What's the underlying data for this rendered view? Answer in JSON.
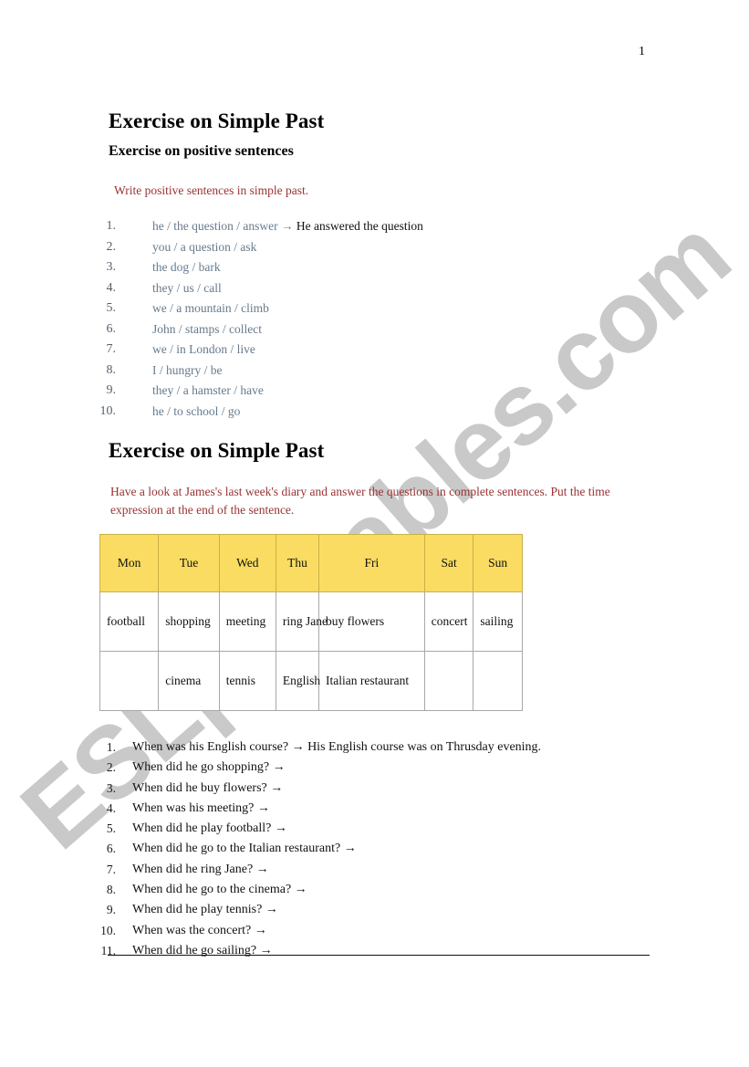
{
  "document": {
    "page_number": "1",
    "watermark": "ESLprintables.com"
  },
  "section_one": {
    "title": "Exercise on Simple Past",
    "subtitle": "Exercise on positive sentences",
    "instruction": "Write positive sentences in simple past.",
    "items": [
      {
        "num": "1.",
        "prompt": "he / the question / answer → ",
        "answer": "He answered the question"
      },
      {
        "num": "2.",
        "prompt": "you / a question / ask",
        "answer": ""
      },
      {
        "num": "3.",
        "prompt": "the dog / bark",
        "answer": ""
      },
      {
        "num": "4.",
        "prompt": "they / us / call",
        "answer": ""
      },
      {
        "num": "5.",
        "prompt": "we / a mountain / climb",
        "answer": ""
      },
      {
        "num": "6.",
        "prompt": "John / stamps / collect",
        "answer": ""
      },
      {
        "num": "7.",
        "prompt": "we / in London / live",
        "answer": ""
      },
      {
        "num": "8.",
        "prompt": "I / hungry / be",
        "answer": ""
      },
      {
        "num": "9.",
        "prompt": "they / a hamster / have",
        "answer": ""
      },
      {
        "num": "10.",
        "prompt": "he / to school / go",
        "answer": ""
      }
    ]
  },
  "section_two": {
    "title": "Exercise on Simple Past",
    "instruction": "Have a look at James's last week's diary and answer the questions in complete sentences. Put the time expression at the end of the sentence.",
    "diary": {
      "headers": [
        "Mon",
        "Tue",
        "Wed",
        "Thu",
        "Fri",
        "Sat",
        "Sun"
      ],
      "rows": [
        [
          "football",
          "shopping",
          "meeting",
          "ring Jane",
          "buy flowers",
          "concert",
          "sailing"
        ],
        [
          "",
          "cinema",
          "tennis",
          "English",
          "Italian restaurant",
          "",
          ""
        ]
      ]
    },
    "questions": [
      {
        "num": "1.",
        "text": "When was his English course? → His English course was on Thrusday evening."
      },
      {
        "num": "2.",
        "text": "When did he go shopping? →"
      },
      {
        "num": "3.",
        "text": "When did he buy flowers? →"
      },
      {
        "num": "4.",
        "text": "When was his meeting? →"
      },
      {
        "num": "5.",
        "text": "When did he play football? →"
      },
      {
        "num": "6.",
        "text": "When did he go to the Italian restaurant? →"
      },
      {
        "num": "7.",
        "text": "When did he ring Jane? →"
      },
      {
        "num": "8.",
        "text": "When did he go to the cinema? →"
      },
      {
        "num": "9.",
        "text": "When did he play tennis? →"
      },
      {
        "num": "10.",
        "text": "When was the concert? →"
      },
      {
        "num": "11.",
        "text": "When did he go sailing? →"
      }
    ]
  },
  "colors": {
    "header_yellow": "#F9DC61",
    "instruction_red": "#993333",
    "prompt_blue_gray": "#667A8C",
    "watermark_gray": "#C9C9C9"
  }
}
